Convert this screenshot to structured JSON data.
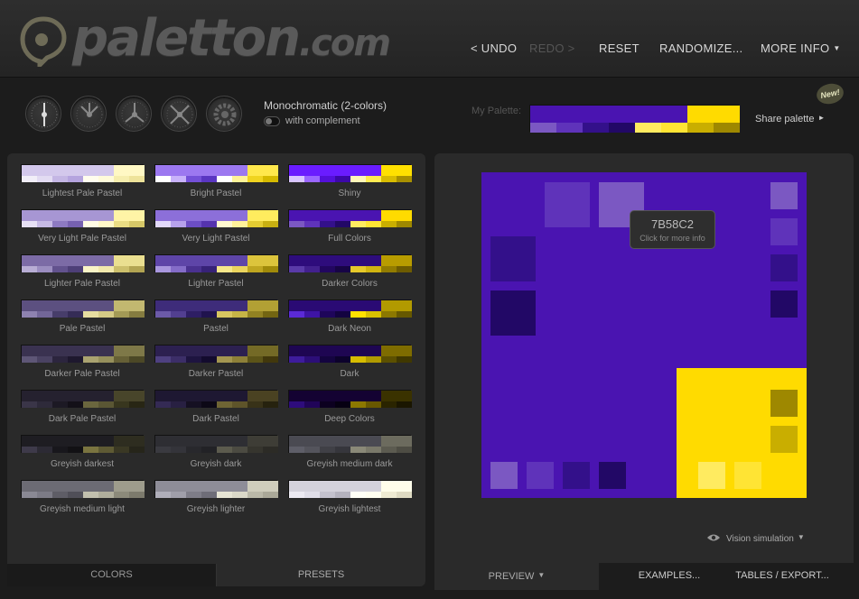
{
  "brand": {
    "logo_main": "paletton",
    "logo_domain": ".com"
  },
  "nav": {
    "undo": "< UNDO",
    "redo": "REDO >",
    "reset": "RESET",
    "randomize": "RANDOMIZE...",
    "more_info": "MORE INFO"
  },
  "scheme": {
    "title": "Monochromatic (2-colors)",
    "complement_label": "with complement",
    "complement_on": false
  },
  "scheme_icons": [
    "mono-wheel-icon",
    "adjacent-wheel-icon",
    "triad-wheel-icon",
    "tetrad-wheel-icon",
    "free-style-wheel-icon"
  ],
  "my_palette": {
    "label": "My Palette:",
    "share": "Share palette",
    "main_color": "#4A14B1",
    "comp_color": "#FFDB00",
    "shades": [
      "#7B58C2",
      "#5F33BA",
      "#33108A",
      "#220866",
      "#FFEB60",
      "#FFE434",
      "#C9AE00",
      "#9E8800"
    ]
  },
  "new_badge": "New!",
  "presets": [
    {
      "label": "Lightest Pale Pastel",
      "main": "#D3C8EC",
      "comp": "#FFF8C4",
      "shades": [
        "#F1EEF8",
        "#E2DBF2",
        "#C4B6E4",
        "#B5A4DE",
        "#FFFDEE",
        "#FFFBDA",
        "#F6EEAE",
        "#EEE39A"
      ]
    },
    {
      "label": "Bright Pastel",
      "main": "#9C78F0",
      "comp": "#FFE84C",
      "shades": [
        "#FFFFFF",
        "#C8B2FA",
        "#7450D8",
        "#5A36C2",
        "#FFFFFF",
        "#FFF398",
        "#F0D420",
        "#D6BA00"
      ]
    },
    {
      "label": "Shiny",
      "main": "#6A1CFF",
      "comp": "#FFE000",
      "shades": [
        "#D9C6FF",
        "#9A66FF",
        "#5410DA",
        "#3C08A8",
        "#FFF6B8",
        "#FFEB52",
        "#D8BC00",
        "#A89000"
      ]
    },
    {
      "label": "Very Light Pale Pastel",
      "main": "#A796D3",
      "comp": "#FFF4A6",
      "shades": [
        "#E6E0F4",
        "#C6BAE4",
        "#8D7AC2",
        "#7661B0",
        "#FFFCE4",
        "#FFF8C8",
        "#EADD84",
        "#D6C868"
      ]
    },
    {
      "label": "Very Light Pastel",
      "main": "#8C6FD9",
      "comp": "#FFEC5E",
      "shades": [
        "#E2D9FA",
        "#B7A2EC",
        "#6C4EC4",
        "#5533AE",
        "#FFF9CE",
        "#FFF29A",
        "#E4CC32",
        "#C8B012"
      ]
    },
    {
      "label": "Full Colors",
      "main": "#4A14B1",
      "comp": "#FFDB00",
      "shades": [
        "#7B58C2",
        "#5F33BA",
        "#33108A",
        "#220866",
        "#FFEB60",
        "#FFE434",
        "#C9AE00",
        "#9E8800"
      ]
    },
    {
      "label": "Lighter Pale Pastel",
      "main": "#7C6BA6",
      "comp": "#EADF90",
      "shades": [
        "#B8ADD4",
        "#9B8DC0",
        "#62528E",
        "#4E3F78",
        "#FAF4C6",
        "#F2E9AC",
        "#CDC06C",
        "#B2A452"
      ]
    },
    {
      "label": "Lighter Pastel",
      "main": "#5E45A8",
      "comp": "#DCC43C",
      "shades": [
        "#A997DE",
        "#846CC8",
        "#4A3190",
        "#372278",
        "#F6E78A",
        "#EAD45E",
        "#BFA620",
        "#A08A0A"
      ]
    },
    {
      "label": "Darker Colors",
      "main": "#2E0C7C",
      "comp": "#B89C00",
      "shades": [
        "#5A3AA8",
        "#42208E",
        "#220660",
        "#170446",
        "#E6C92A",
        "#D0B410",
        "#927C00",
        "#6E5C00"
      ]
    },
    {
      "label": "Pale Pastel",
      "main": "#5C5080",
      "comp": "#C2B870",
      "shades": [
        "#8E82B0",
        "#726698",
        "#473D6A",
        "#352C56",
        "#E6DDA0",
        "#D4CA86",
        "#A39A56",
        "#857C40"
      ]
    },
    {
      "label": "Pastel",
      "main": "#3E2C7A",
      "comp": "#B2A034",
      "shades": [
        "#6C5AA8",
        "#523F90",
        "#2E1E64",
        "#20134E",
        "#D8C660",
        "#C6B446",
        "#928222",
        "#736512"
      ]
    },
    {
      "label": "Dark Neon",
      "main": "#2A0A74",
      "comp": "#B29A00",
      "shades": [
        "#5B2AD6",
        "#3E14A4",
        "#1E055A",
        "#130340",
        "#FFE100",
        "#D8C000",
        "#8C7800",
        "#665800"
      ]
    },
    {
      "label": "Darker Pale Pastel",
      "main": "#3A3250",
      "comp": "#7E7848",
      "shades": [
        "#5E5676",
        "#4A4262",
        "#2C253E",
        "#1E182E",
        "#AAA370",
        "#96905C",
        "#666036",
        "#4C4826"
      ]
    },
    {
      "label": "Darker Pastel",
      "main": "#2C2050",
      "comp": "#746A26",
      "shades": [
        "#4E4080",
        "#3C2E68",
        "#1E1440",
        "#130B2E",
        "#A49650",
        "#8E8038",
        "#5C5418",
        "#42380C"
      ]
    },
    {
      "label": "Dark",
      "main": "#1E0652",
      "comp": "#7E6C00",
      "shades": [
        "#3E1C9C",
        "#2C0E78",
        "#140440",
        "#0C022C",
        "#D6BC00",
        "#B09A00",
        "#5C5000",
        "#403800"
      ]
    },
    {
      "label": "Dark Pale Pastel",
      "main": "#25212F",
      "comp": "#48452A",
      "shades": [
        "#3A3548",
        "#2E2A3A",
        "#1C1924",
        "#131018",
        "#6A663E",
        "#5A5634",
        "#38361E",
        "#282614"
      ]
    },
    {
      "label": "Dark Pastel",
      "main": "#1E1832",
      "comp": "#4A4222",
      "shades": [
        "#342A54",
        "#282042",
        "#151022",
        "#0C0816",
        "#6E6434",
        "#5E542A",
        "#383218",
        "#26220E"
      ]
    },
    {
      "label": "Deep Colors",
      "main": "#140232",
      "comp": "#3A3200",
      "shades": [
        "#2E0C7C",
        "#200458",
        "#0C0020",
        "#060012",
        "#8C7800",
        "#685800",
        "#2A2400",
        "#1A1600"
      ]
    },
    {
      "label": "Greyish darkest",
      "main": "#1E1D22",
      "comp": "#2E2D20",
      "shades": [
        "#3E3A4A",
        "#2C2A34",
        "#18171C",
        "#121114",
        "#7A7440",
        "#5E5A34",
        "#3A3824",
        "#26251A"
      ]
    },
    {
      "label": "Greyish dark",
      "main": "#2E2E33",
      "comp": "#3E3D36",
      "shades": [
        "#3A3A40",
        "#34343A",
        "#28282C",
        "#222226",
        "#5C5B4E",
        "#4C4B42",
        "#36352E",
        "#2C2B26"
      ]
    },
    {
      "label": "Greyish medium dark",
      "main": "#4A4A52",
      "comp": "#6C6B5E",
      "shades": [
        "#5E5E68",
        "#54545C",
        "#404046",
        "#36363C",
        "#8A8978",
        "#7A796A",
        "#5C5B50",
        "#4E4D44"
      ]
    },
    {
      "label": "Greyish medium light",
      "main": "#6C6B74",
      "comp": "#9E9C8C",
      "shades": [
        "#8A8994",
        "#7C7B86",
        "#5E5D66",
        "#504F58",
        "#C2C0AE",
        "#B0AE9C",
        "#8C8A7A",
        "#7C7A6C"
      ]
    },
    {
      "label": "Greyish lighter",
      "main": "#8E8D98",
      "comp": "#CFCDBC",
      "shades": [
        "#B0AFBA",
        "#A09FAA",
        "#7E7D88",
        "#6E6D78",
        "#E6E4D4",
        "#DAD8C8",
        "#BAB8A8",
        "#AAA898"
      ]
    },
    {
      "label": "Greyish lightest",
      "main": "#D4D2DC",
      "comp": "#FFFDEA",
      "shades": [
        "#ECEAF2",
        "#E0DEE8",
        "#C4C2CE",
        "#B4B2BE",
        "#FFFFF6",
        "#FFFEF0",
        "#EEEAD2",
        "#DEDAC2"
      ]
    }
  ],
  "left_tabs": {
    "colors": "COLORS",
    "presets": "PRESETS"
  },
  "preview": {
    "base_color": "#4A14B1",
    "comp_color": "#FFDB00",
    "tooltip_hex": "7B58C2",
    "tooltip_hint": "Click for more info",
    "vision": "Vision simulation"
  },
  "right_tabs": {
    "preview": "PREVIEW",
    "examples": "EXAMPLES...",
    "tables": "TABLES / EXPORT..."
  }
}
